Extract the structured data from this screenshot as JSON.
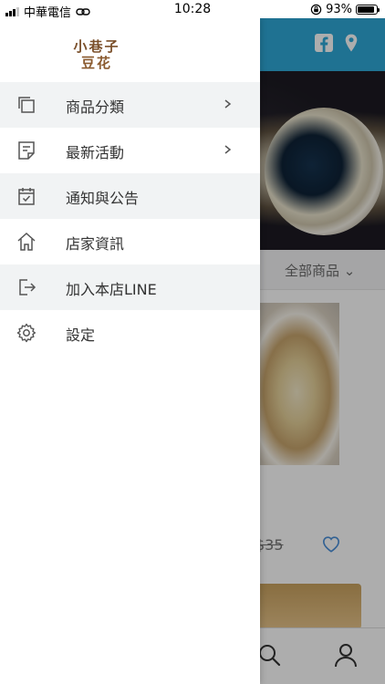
{
  "status_bar": {
    "carrier": "中華電信",
    "time": "10:28",
    "battery": "93%",
    "battery_level": 0.93
  },
  "drawer": {
    "logo": {
      "line1": "小巷子",
      "line2": "豆花"
    },
    "menu": [
      {
        "label": "商品分類",
        "icon": "copy-icon",
        "has_chevron": true
      },
      {
        "label": "最新活動",
        "icon": "note-icon",
        "has_chevron": true
      },
      {
        "label": "通知與公告",
        "icon": "calendar-check-icon",
        "has_chevron": false
      },
      {
        "label": "店家資訊",
        "icon": "home-icon",
        "has_chevron": false
      },
      {
        "label": "加入本店LINE",
        "icon": "sign-out-icon",
        "has_chevron": false
      },
      {
        "label": "設定",
        "icon": "gear-icon",
        "has_chevron": false
      }
    ]
  },
  "background_app": {
    "header_icons": [
      "facebook-icon",
      "location-pin-icon"
    ],
    "filter_label": "全部商品",
    "product": {
      "price_partial": "$35"
    },
    "tab_icons": [
      "search-icon",
      "user-icon"
    ],
    "colors": {
      "header": "#2fa8d8",
      "heart": "#4a90d9"
    }
  }
}
